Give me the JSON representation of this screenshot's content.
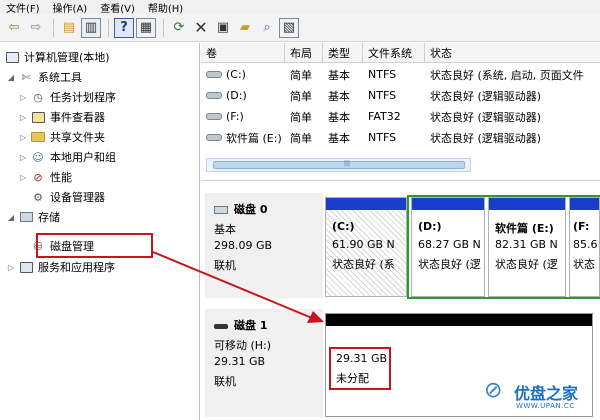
{
  "menu": [
    "文件(F)",
    "操作(A)",
    "查看(V)",
    "帮助(H)"
  ],
  "toolbar": {
    "icons": [
      "back-arrow-icon",
      "forward-arrow-icon",
      "up-folder-icon",
      "show-tree-icon",
      "help-icon",
      "properties-icon",
      "refresh-icon",
      "close-icon",
      "open-properties-icon",
      "folder-open-icon",
      "search-zoom-icon",
      "mmc-icon"
    ]
  },
  "tree": {
    "root": "计算机管理(本地)",
    "system_tools": "系统工具",
    "task_scheduler": "任务计划程序",
    "event_viewer": "事件查看器",
    "shared_folders": "共享文件夹",
    "local_users": "本地用户和组",
    "performance": "性能",
    "device_manager": "设备管理器",
    "storage": "存储",
    "disk_management": "磁盘管理",
    "services": "服务和应用程序"
  },
  "volume_table": {
    "headers": [
      "卷",
      "布局",
      "类型",
      "文件系统",
      "状态"
    ],
    "rows": [
      {
        "volume": "(C:)",
        "layout": "简单",
        "type": "基本",
        "fs": "NTFS",
        "status": "状态良好 (系统, 启动, 页面文件"
      },
      {
        "volume": "(D:)",
        "layout": "简单",
        "type": "基本",
        "fs": "NTFS",
        "status": "状态良好 (逻辑驱动器)"
      },
      {
        "volume": "(F:)",
        "layout": "简单",
        "type": "基本",
        "fs": "FAT32",
        "status": "状态良好 (逻辑驱动器)"
      },
      {
        "volume": "软件篇 (E:)",
        "layout": "简单",
        "type": "基本",
        "fs": "NTFS",
        "status": "状态良好 (逻辑驱动器)"
      }
    ]
  },
  "disk0": {
    "name": "磁盘 0",
    "type": "基本",
    "size": "298.09 GB",
    "state": "联机",
    "partitions": [
      {
        "label": "(C:)",
        "size": "61.90 GB N",
        "status": "状态良好 (系"
      },
      {
        "label": "(D:)",
        "size": "68.27 GB N",
        "status": "状态良好 (逻"
      },
      {
        "label": "软件篇 (E:)",
        "size": "82.31 GB N",
        "status": "状态良好 (逻"
      },
      {
        "label": "(F:",
        "size": "85.6",
        "status": "状态"
      }
    ]
  },
  "disk1": {
    "name": "磁盘 1",
    "type": "可移动 (H:)",
    "size": "29.31 GB",
    "state": "联机",
    "unallocated_size": "29.31 GB",
    "unallocated_label": "未分配"
  },
  "watermark": {
    "text": "优盘之家",
    "url": "WWW.UPAN.CC"
  },
  "colors": {
    "partition_bar": "#1a3ecc",
    "unallocated_bar": "#000000",
    "extended_border": "#2a9a2a",
    "callout": "#c8141e"
  }
}
